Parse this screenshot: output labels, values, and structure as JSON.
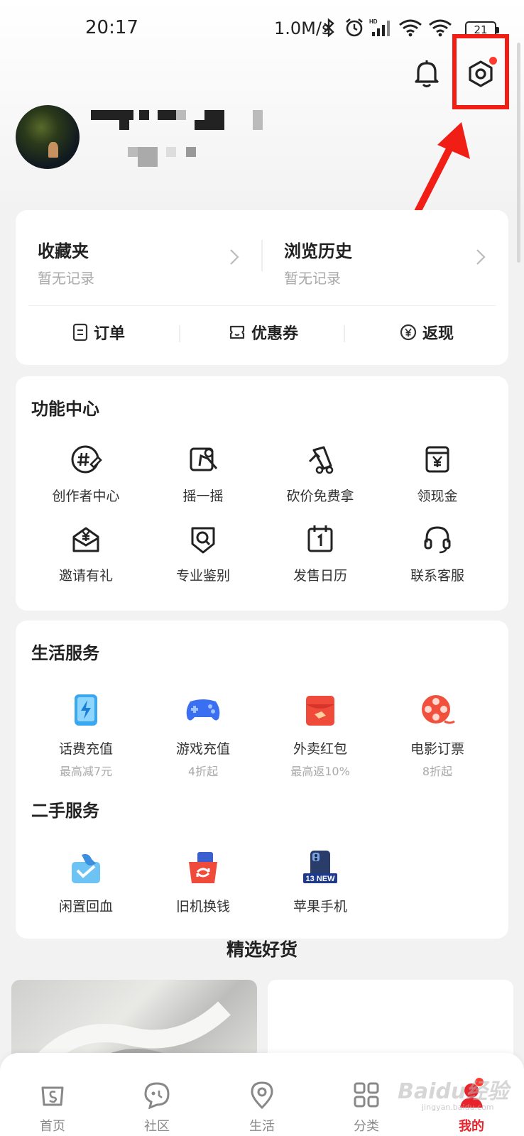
{
  "status_bar": {
    "time": "20:17",
    "speed": "1.0M/s",
    "battery": "21"
  },
  "header": {
    "bell_icon": "bell-icon",
    "settings_icon": "settings-gear-icon"
  },
  "profile": {},
  "collections": {
    "favorites_title": "收藏夹",
    "favorites_sub": "暂无记录",
    "history_title": "浏览历史",
    "history_sub": "暂无记录"
  },
  "quick_links": [
    {
      "label": "订单",
      "icon": "order-icon"
    },
    {
      "label": "优惠券",
      "icon": "coupon-icon"
    },
    {
      "label": "返现",
      "icon": "cashback-icon"
    }
  ],
  "function_center": {
    "title": "功能中心",
    "items": [
      {
        "label": "创作者中心",
        "icon": "creator-icon"
      },
      {
        "label": "摇一摇",
        "icon": "shake-icon"
      },
      {
        "label": "砍价免费拿",
        "icon": "bargain-icon"
      },
      {
        "label": "领现金",
        "icon": "cash-icon"
      },
      {
        "label": "邀请有礼",
        "icon": "invite-icon"
      },
      {
        "label": "专业鉴别",
        "icon": "authenticate-icon"
      },
      {
        "label": "发售日历",
        "icon": "calendar-icon"
      },
      {
        "label": "联系客服",
        "icon": "headset-icon"
      }
    ]
  },
  "life_services": {
    "title": "生活服务",
    "items": [
      {
        "label": "话费充值",
        "sub": "最高减7元",
        "icon": "phone-recharge-icon",
        "color": "#3aa8f0"
      },
      {
        "label": "游戏充值",
        "sub": "4折起",
        "icon": "gamepad-icon",
        "color": "#3b6ff2"
      },
      {
        "label": "外卖红包",
        "sub": "最高返10%",
        "icon": "red-envelope-icon",
        "color": "#f04a3a"
      },
      {
        "label": "电影订票",
        "sub": "8折起",
        "icon": "film-reel-icon",
        "color": "#f0503c"
      }
    ]
  },
  "second_hand": {
    "title": "二手服务",
    "items": [
      {
        "label": "闲置回血",
        "icon": "idle-resale-icon"
      },
      {
        "label": "旧机换钱",
        "icon": "trade-in-icon"
      },
      {
        "label": "苹果手机",
        "icon": "iphone-icon",
        "badge": "13 NEW"
      }
    ]
  },
  "picks": {
    "title": "精选好货"
  },
  "tabs": [
    {
      "label": "首页",
      "icon": "home-icon"
    },
    {
      "label": "社区",
      "icon": "community-icon"
    },
    {
      "label": "生活",
      "icon": "location-pin-icon"
    },
    {
      "label": "分类",
      "icon": "grid-icon"
    },
    {
      "label": "我的",
      "icon": "profile-icon",
      "active": true
    }
  ],
  "watermark": {
    "brand": "Baidu经验",
    "url": "jingyan.baidu.com"
  }
}
